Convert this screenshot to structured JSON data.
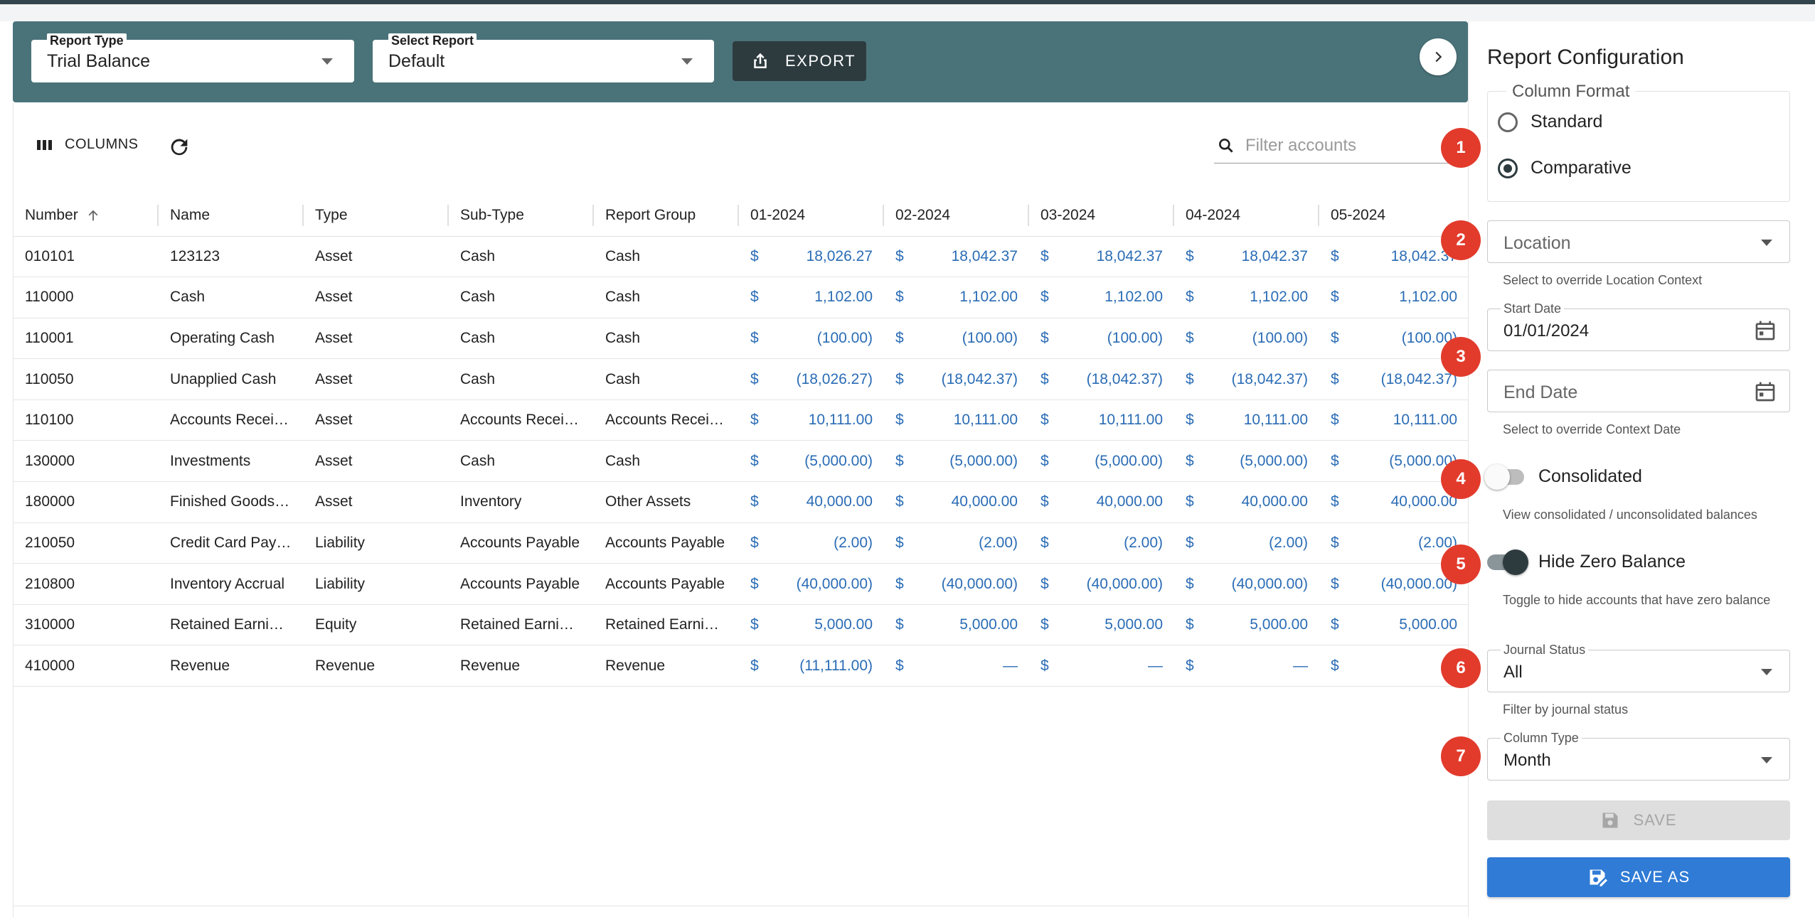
{
  "header": {
    "report_type": {
      "label": "Report Type",
      "value": "Trial Balance"
    },
    "select_report": {
      "label": "Select Report",
      "value": "Default"
    },
    "export_label": "EXPORT"
  },
  "toolbar": {
    "columns_label": "COLUMNS",
    "filter_placeholder": "Filter accounts"
  },
  "table": {
    "columns": [
      "Number",
      "Name",
      "Type",
      "Sub-Type",
      "Report Group",
      "01-2024",
      "02-2024",
      "03-2024",
      "04-2024",
      "05-2024"
    ],
    "rows": [
      {
        "number": "010101",
        "name": "123123",
        "type": "Asset",
        "subtype": "Cash",
        "group": "Cash",
        "values": [
          "18,026.27",
          "18,042.37",
          "18,042.37",
          "18,042.37",
          "18,042.37"
        ]
      },
      {
        "number": "110000",
        "name": "Cash",
        "type": "Asset",
        "subtype": "Cash",
        "group": "Cash",
        "values": [
          "1,102.00",
          "1,102.00",
          "1,102.00",
          "1,102.00",
          "1,102.00"
        ]
      },
      {
        "number": "110001",
        "name": "Operating Cash",
        "type": "Asset",
        "subtype": "Cash",
        "group": "Cash",
        "values": [
          "(100.00)",
          "(100.00)",
          "(100.00)",
          "(100.00)",
          "(100.00)"
        ]
      },
      {
        "number": "110050",
        "name": "Unapplied Cash",
        "type": "Asset",
        "subtype": "Cash",
        "group": "Cash",
        "values": [
          "(18,026.27)",
          "(18,042.37)",
          "(18,042.37)",
          "(18,042.37)",
          "(18,042.37)"
        ]
      },
      {
        "number": "110100",
        "name": "Accounts Recei…",
        "type": "Asset",
        "subtype": "Accounts Recei…",
        "group": "Accounts Recei…",
        "values": [
          "10,111.00",
          "10,111.00",
          "10,111.00",
          "10,111.00",
          "10,111.00"
        ]
      },
      {
        "number": "130000",
        "name": "Investments",
        "type": "Asset",
        "subtype": "Cash",
        "group": "Cash",
        "values": [
          "(5,000.00)",
          "(5,000.00)",
          "(5,000.00)",
          "(5,000.00)",
          "(5,000.00)"
        ]
      },
      {
        "number": "180000",
        "name": "Finished Goods…",
        "type": "Asset",
        "subtype": "Inventory",
        "group": "Other Assets",
        "values": [
          "40,000.00",
          "40,000.00",
          "40,000.00",
          "40,000.00",
          "40,000.00"
        ]
      },
      {
        "number": "210050",
        "name": "Credit Card Pay…",
        "type": "Liability",
        "subtype": "Accounts Payable",
        "group": "Accounts Payable",
        "values": [
          "(2.00)",
          "(2.00)",
          "(2.00)",
          "(2.00)",
          "(2.00)"
        ]
      },
      {
        "number": "210800",
        "name": "Inventory Accrual",
        "type": "Liability",
        "subtype": "Accounts Payable",
        "group": "Accounts Payable",
        "values": [
          "(40,000.00)",
          "(40,000.00)",
          "(40,000.00)",
          "(40,000.00)",
          "(40,000.00)"
        ]
      },
      {
        "number": "310000",
        "name": "Retained Earni…",
        "type": "Equity",
        "subtype": "Retained Earni…",
        "group": "Retained Earni…",
        "values": [
          "5,000.00",
          "5,000.00",
          "5,000.00",
          "5,000.00",
          "5,000.00"
        ]
      },
      {
        "number": "410000",
        "name": "Revenue",
        "type": "Revenue",
        "subtype": "Revenue",
        "group": "Revenue",
        "values": [
          "(11,111.00)",
          "—",
          "—",
          "—",
          ""
        ]
      }
    ],
    "currency_symbol": "$"
  },
  "panel": {
    "title": "Report Configuration",
    "column_format": {
      "legend": "Column Format",
      "options": [
        "Standard",
        "Comparative"
      ],
      "selected": "Comparative"
    },
    "location": {
      "placeholder": "Location",
      "help": "Select to override Location Context"
    },
    "start_date": {
      "label": "Start Date",
      "value": "01/01/2024"
    },
    "end_date": {
      "placeholder": "End Date",
      "help": "Select to override Context Date"
    },
    "consolidated": {
      "label": "Consolidated",
      "on": false,
      "help": "View consolidated / unconsolidated balances"
    },
    "hide_zero": {
      "label": "Hide Zero Balance",
      "on": true,
      "help": "Toggle to hide accounts that have zero balance"
    },
    "journal_status": {
      "label": "Journal Status",
      "value": "All",
      "help": "Filter by journal status"
    },
    "column_type": {
      "label": "Column Type",
      "value": "Month"
    },
    "save_label": "SAVE",
    "save_as_label": "SAVE AS"
  },
  "badges": [
    "1",
    "2",
    "3",
    "4",
    "5",
    "6",
    "7"
  ],
  "colors": {
    "header_bg": "#4a7379",
    "dark": "#2d3b3f",
    "link_blue": "#2a6cb5",
    "primary": "#2f7bd6",
    "badge_red": "#e23b2c"
  }
}
